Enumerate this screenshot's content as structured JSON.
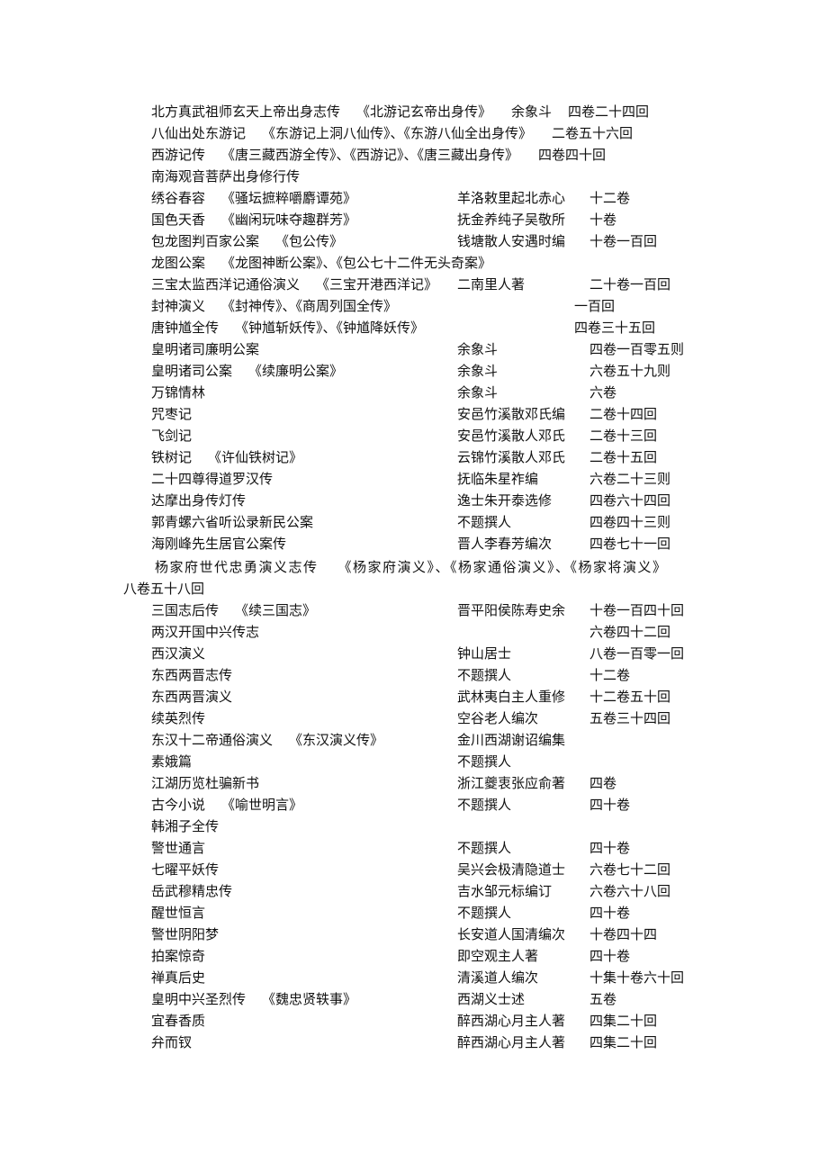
{
  "rows": [
    {
      "title": "北方真武祖师玄天上帝出身志传",
      "alt": "《北游记玄帝出身传》",
      "author": "余象斗",
      "volumes": "四卷二十四回"
    },
    {
      "title": "八仙出处东游记",
      "alt": "《东游记上洞八仙传》、《东游八仙全出身传》",
      "author": "",
      "volumes": "二卷五十六回"
    },
    {
      "title": "西游记传",
      "alt": "《唐三藏西游全传》、《西游记》、《唐三藏出身传》",
      "author": "",
      "volumes": "四卷四十回"
    },
    {
      "title": "南海观音菩萨出身修行传",
      "alt": "",
      "author": "",
      "volumes": ""
    },
    {
      "title": "绣谷春容",
      "alt": "《骚坛摭粹嚼麝谭苑》",
      "author": "羊洛敕里起北赤心",
      "volumes": "十二卷"
    },
    {
      "title": "国色天香",
      "alt": "《幽闲玩味夺趣群芳》",
      "author": "抚金养纯子吴敬所",
      "volumes": "十卷"
    },
    {
      "title": "包龙图判百家公案",
      "alt": "《包公传》",
      "author": "钱塘散人安遇时编",
      "volumes": "十卷一百回"
    },
    {
      "title": "龙图公案",
      "alt": "《龙图神断公案》、《包公七十二件无头奇案》",
      "author": "",
      "volumes": ""
    },
    {
      "title": "三宝太监西洋记通俗演义",
      "alt": "《三宝开港西洋记》",
      "author": "二南里人著",
      "volumes": "二十卷一百回"
    },
    {
      "title": "封神演义",
      "alt": "《封神传》、《商周列国全传》",
      "author": "",
      "volumes": "一百回"
    },
    {
      "title": "唐钟馗全传",
      "alt": "《钟馗斩妖传》、《钟馗降妖传》",
      "author": "",
      "volumes": "四卷三十五回"
    },
    {
      "title": "皇明诸司廉明公案",
      "alt": "",
      "author": "余象斗",
      "volumes": "四卷一百零五则"
    },
    {
      "title": "皇明诸司公案",
      "alt": "《续廉明公案》",
      "author": "余象斗",
      "volumes": "六卷五十九则"
    },
    {
      "title": "万锦情林",
      "alt": "",
      "author": "余象斗",
      "volumes": "六卷"
    },
    {
      "title": "咒枣记",
      "alt": "",
      "author": "安邑竹溪散邓氏编",
      "volumes": "二卷十四回"
    },
    {
      "title": "飞剑记",
      "alt": "",
      "author": "安邑竹溪散人邓氏",
      "volumes": "二卷十三回"
    },
    {
      "title": "铁树记",
      "alt": "《许仙铁树记》",
      "author": "云锦竹溪散人邓氏",
      "volumes": "二卷十五回"
    },
    {
      "title": "二十四尊得道罗汉传",
      "alt": "",
      "author": "抚临朱星祚编",
      "volumes": "六卷二十三则"
    },
    {
      "title": "达摩出身传灯传",
      "alt": "",
      "author": "逸士朱开泰选修",
      "volumes": "四卷六十四回"
    },
    {
      "title": "郭青螺六省听讼录新民公案",
      "alt": "",
      "author": "不题撰人",
      "volumes": "四卷四十三则"
    },
    {
      "title": "海刚峰先生居官公案传",
      "alt": "",
      "author": "晋人李春芳编次",
      "volumes": "四卷七十一回"
    },
    {
      "title": "杨家府世代忠勇演义志传",
      "alt": "《杨家府演义》、《杨家通俗演义》、《杨家将演义》",
      "author": "",
      "volumes": "八卷五十八回"
    },
    {
      "title": "三国志后传",
      "alt": "《续三国志》",
      "author": "晋平阳侯陈寿史余",
      "volumes": "十卷一百四十回"
    },
    {
      "title": "两汉开国中兴传志",
      "alt": "",
      "author": "",
      "volumes": "六卷四十二回"
    },
    {
      "title": "西汉演义",
      "alt": "",
      "author": "钟山居士",
      "volumes": "八卷一百零一回"
    },
    {
      "title": "东西两晋志传",
      "alt": "",
      "author": "不题撰人",
      "volumes": "十二卷"
    },
    {
      "title": "东西两晋演义",
      "alt": "",
      "author": "武林夷白主人重修",
      "volumes": "十二卷五十回"
    },
    {
      "title": "续英烈传",
      "alt": "",
      "author": "空谷老人编次",
      "volumes": "五卷三十四回"
    },
    {
      "title": "东汉十二帝通俗演义",
      "alt": "《东汉演义传》",
      "author": "金川西湖谢诏编集",
      "volumes": ""
    },
    {
      "title": "素娥篇",
      "alt": "",
      "author": "不题撰人",
      "volumes": ""
    },
    {
      "title": "江湖历览杜骗新书",
      "alt": "",
      "author": "浙江夔衷张应俞著",
      "volumes": "四卷"
    },
    {
      "title": "古今小说",
      "alt": "《喻世明言》",
      "author": "不题撰人",
      "volumes": "四十卷"
    },
    {
      "title": "韩湘子全传",
      "alt": "",
      "author": "",
      "volumes": ""
    },
    {
      "title": "警世通言",
      "alt": "",
      "author": "不题撰人",
      "volumes": "四十卷"
    },
    {
      "title": "七曜平妖传",
      "alt": "",
      "author": "吴兴会极清隐道士",
      "volumes": "六卷七十二回"
    },
    {
      "title": "岳武穆精忠传",
      "alt": "",
      "author": "吉水邹元标编订",
      "volumes": "六卷六十八回"
    },
    {
      "title": "醒世恒言",
      "alt": "",
      "author": "不题撰人",
      "volumes": "四十卷"
    },
    {
      "title": "警世阴阳梦",
      "alt": "",
      "author": "长安道人国清编次",
      "volumes": "十卷四十四"
    },
    {
      "title": "拍案惊奇",
      "alt": "",
      "author": "即空观主人著",
      "volumes": "四十卷"
    },
    {
      "title": "禅真后史",
      "alt": "",
      "author": "清溪道人编次",
      "volumes": "十集十卷六十回"
    },
    {
      "title": "皇明中兴圣烈传",
      "alt": "《魏忠贤轶事》",
      "author": "西湖义士述",
      "volumes": "五卷"
    },
    {
      "title": "宜春香质",
      "alt": "",
      "author": "醉西湖心月主人著",
      "volumes": "四集二十回"
    },
    {
      "title": "弁而钗",
      "alt": "",
      "author": "醉西湖心月主人著",
      "volumes": "四集二十回"
    }
  ]
}
